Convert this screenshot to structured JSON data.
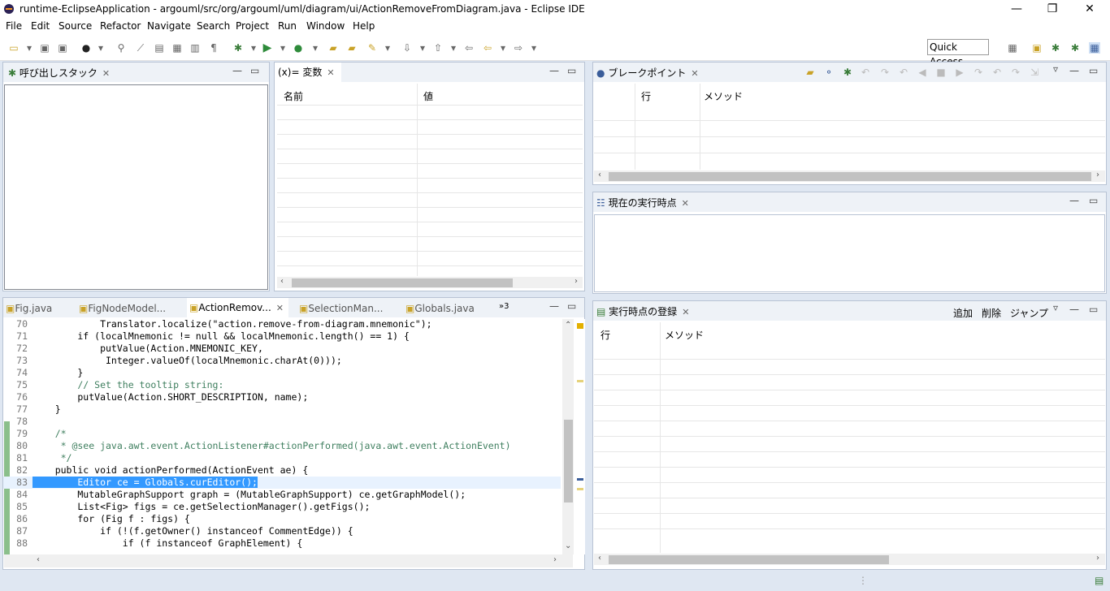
{
  "window": {
    "title": "runtime-EclipseApplication - argouml/src/org/argouml/uml/diagram/ui/ActionRemoveFromDiagram.java - Eclipse IDE",
    "min_label": "—",
    "max_label": "❐",
    "close_label": "✕"
  },
  "menu": [
    "File",
    "Edit",
    "Source",
    "Refactor",
    "Navigate",
    "Search",
    "Project",
    "Run",
    "Window",
    "Help"
  ],
  "toolbar": {
    "quick_access": "Quick Access"
  },
  "callstack": {
    "title": "呼び出しスタック"
  },
  "variables": {
    "title": "(x)= 変数",
    "col_name": "名前",
    "col_value": "値"
  },
  "breakpoints": {
    "title": "ブレークポイント",
    "col_line": "行",
    "col_method": "メソッド"
  },
  "current_point": {
    "title": "現在の実行時点"
  },
  "registered_points": {
    "title": "実行時点の登録",
    "add": "追加",
    "delete": "削除",
    "jump": "ジャンプ",
    "col_line": "行",
    "col_method": "メソッド"
  },
  "editor": {
    "tabs": [
      {
        "label": "Fig.java"
      },
      {
        "label": "FigNodeModel..."
      },
      {
        "label": "ActionRemov..."
      },
      {
        "label": "SelectionMan..."
      },
      {
        "label": "Globals.java"
      }
    ],
    "overflow": "»3",
    "lines": [
      {
        "num": "70",
        "text": "            Translator.localize(\"action.remove-from-diagram.mnemonic\");"
      },
      {
        "num": "71",
        "text": "        if (localMnemonic != null && localMnemonic.length() == 1) {"
      },
      {
        "num": "72",
        "text": "            putValue(Action.MNEMONIC_KEY,"
      },
      {
        "num": "73",
        "text": "             Integer.valueOf(localMnemonic.charAt(0)));"
      },
      {
        "num": "74",
        "text": "        }"
      },
      {
        "num": "75",
        "text": "        // Set the tooltip string:"
      },
      {
        "num": "76",
        "text": "        putValue(Action.SHORT_DESCRIPTION, name);"
      },
      {
        "num": "77",
        "text": "    }"
      },
      {
        "num": "78",
        "text": ""
      },
      {
        "num": "79",
        "text": "    /*"
      },
      {
        "num": "80",
        "text": "     * @see java.awt.event.ActionListener#actionPerformed(java.awt.event.ActionEvent)"
      },
      {
        "num": "81",
        "text": "     */"
      },
      {
        "num": "82",
        "text": "    public void actionPerformed(ActionEvent ae) {"
      },
      {
        "num": "83",
        "text": "        Editor ce = Globals.curEditor();"
      },
      {
        "num": "84",
        "text": "        MutableGraphSupport graph = (MutableGraphSupport) ce.getGraphModel();"
      },
      {
        "num": "85",
        "text": "        List<Fig> figs = ce.getSelectionManager().getFigs();"
      },
      {
        "num": "86",
        "text": "        for (Fig f : figs) {"
      },
      {
        "num": "87",
        "text": "            if (!(f.getOwner() instanceof CommentEdge)) {"
      },
      {
        "num": "88",
        "text": "                if (f instanceof GraphElement) {"
      }
    ]
  }
}
